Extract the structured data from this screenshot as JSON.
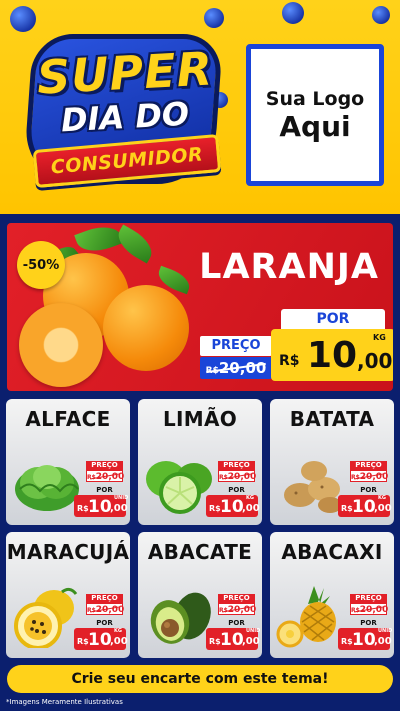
{
  "header": {
    "brand_line1": "SUPER",
    "brand_line2": "DIA DO",
    "brand_line3": "CONSUMIDOR",
    "logo_line1": "Sua Logo",
    "logo_line2": "Aqui"
  },
  "featured": {
    "discount_badge": "-50%",
    "name": "LARANJA",
    "preco_label": "PREÇO",
    "old_currency": "R$",
    "old_price": "20,00",
    "por_label": "POR",
    "currency": "R$",
    "price_int": "10",
    "price_dec": ",00",
    "unit": "KG"
  },
  "products": [
    {
      "name": "ALFACE",
      "preco_label": "PREÇO",
      "old_currency": "R$",
      "old_price": "20,00",
      "por_label": "POR",
      "currency": "R$",
      "price_int": "10",
      "price_dec": ",00",
      "unit": "UNID"
    },
    {
      "name": "LIMÃO",
      "preco_label": "PREÇO",
      "old_currency": "R$",
      "old_price": "20,00",
      "por_label": "POR",
      "currency": "R$",
      "price_int": "10",
      "price_dec": ",00",
      "unit": "KG"
    },
    {
      "name": "BATATA",
      "preco_label": "PREÇO",
      "old_currency": "R$",
      "old_price": "20,00",
      "por_label": "POR",
      "currency": "R$",
      "price_int": "10",
      "price_dec": ",00",
      "unit": "KG"
    },
    {
      "name": "MARACUJÁ",
      "preco_label": "PREÇO",
      "old_currency": "R$",
      "old_price": "20,00",
      "por_label": "POR",
      "currency": "R$",
      "price_int": "10",
      "price_dec": ",00",
      "unit": "KG"
    },
    {
      "name": "ABACATE",
      "preco_label": "PREÇO",
      "old_currency": "R$",
      "old_price": "20,00",
      "por_label": "POR",
      "currency": "R$",
      "price_int": "10",
      "price_dec": ",00",
      "unit": "UNID"
    },
    {
      "name": "ABACAXI",
      "preco_label": "PREÇO",
      "old_currency": "R$",
      "old_price": "20,00",
      "por_label": "POR",
      "currency": "R$",
      "price_int": "10",
      "price_dec": ",00",
      "unit": "UNID"
    }
  ],
  "cta": {
    "label": "Crie seu encarte com este tema!"
  },
  "footnote": "*Imagens Meramente Ilustrativas",
  "colors": {
    "yellow": "#ffd21a",
    "red": "#e22028",
    "blue": "#1a45d8",
    "navy": "#0b1f6e"
  }
}
